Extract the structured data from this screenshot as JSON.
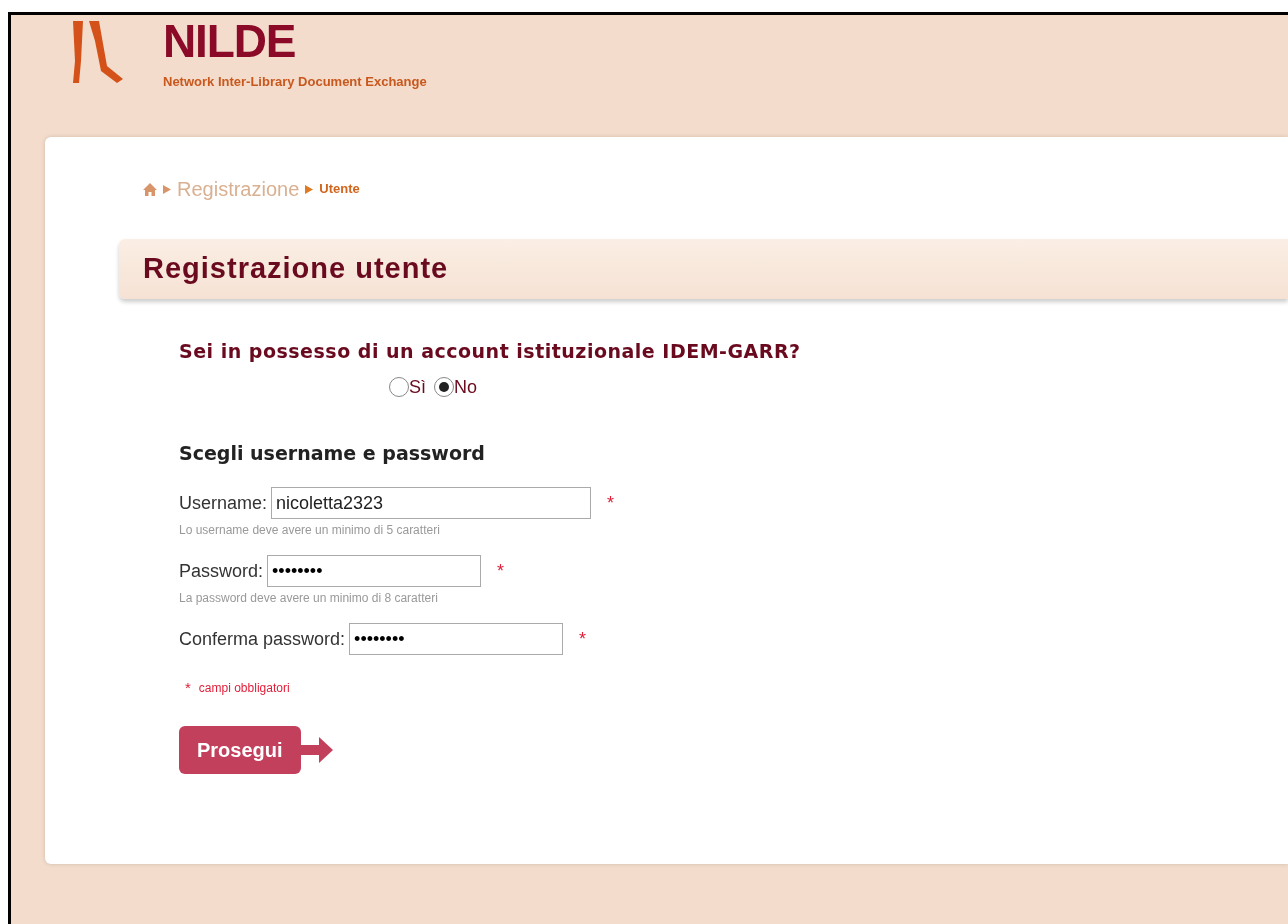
{
  "logo": {
    "title": "NILDE",
    "subtitle": "Network Inter-Library Document Exchange"
  },
  "breadcrumb": [
    {
      "label": "Registrazione",
      "current": false
    },
    {
      "label": "Utente",
      "current": true
    }
  ],
  "heading": "Registrazione utente",
  "idem": {
    "question": "Sei in possesso di un account istituzionale IDEM-GARR?",
    "options": [
      {
        "label": "Sì",
        "selected": false
      },
      {
        "label": "No",
        "selected": true
      }
    ]
  },
  "section_title": "Scegli username e password",
  "fields": [
    {
      "label": "Username:",
      "value": "nicoletta2323",
      "kind": "text",
      "required": true,
      "hint": "Lo username deve avere un minimo di 5 caratteri"
    },
    {
      "label": "Password:",
      "value": "••••••••",
      "kind": "password",
      "required": true,
      "hint": "La password deve avere un minimo di 8 caratteri"
    },
    {
      "label": "Conferma password:",
      "value": "••••••••",
      "kind": "password",
      "required": true
    }
  ],
  "required_note": {
    "mark": "*",
    "text": "campi obbligatori"
  },
  "submit": "Prosegui"
}
